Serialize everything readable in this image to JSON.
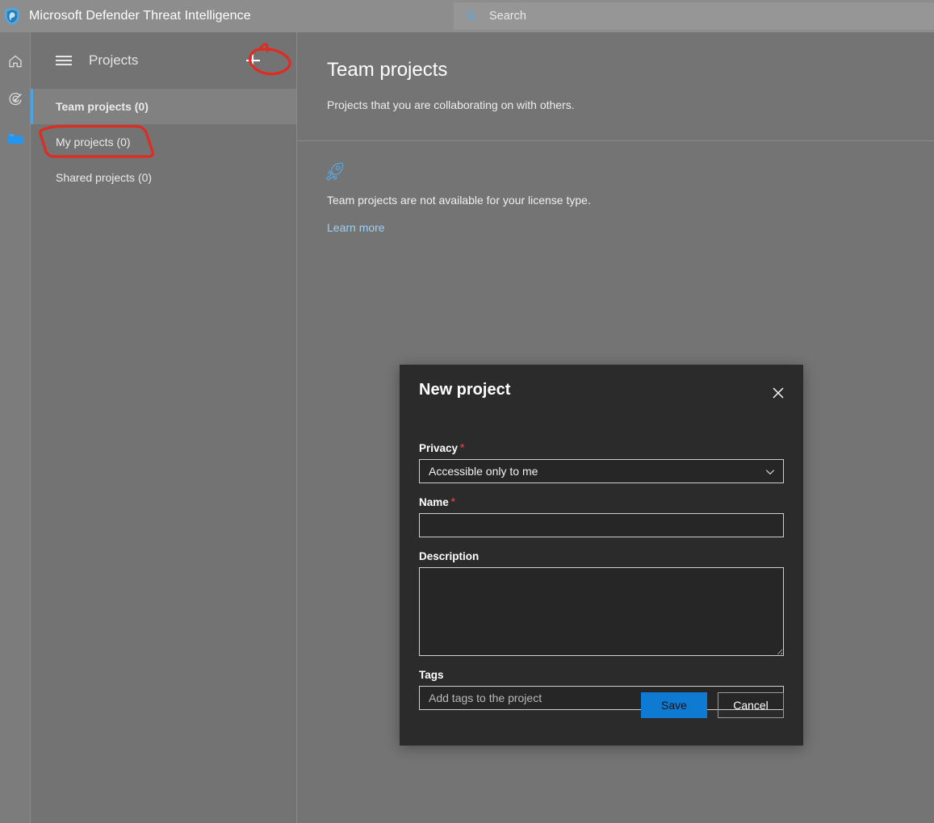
{
  "app": {
    "title": "Microsoft Defender Threat Intelligence",
    "shield_icon": "shield-icon"
  },
  "search": {
    "placeholder": "Search",
    "icon": "search-icon"
  },
  "rail": {
    "items": [
      {
        "name": "home",
        "icon": "home-icon",
        "active": false
      },
      {
        "name": "intel-explorer",
        "icon": "target-icon",
        "active": false
      },
      {
        "name": "projects",
        "icon": "folder-icon",
        "active": true
      }
    ],
    "active_color": "#3ba3ec"
  },
  "panel": {
    "menu_icon": "hamburger-menu-icon",
    "title": "Projects",
    "add_icon": "plus-icon",
    "items": [
      {
        "label": "Team projects (0)",
        "selected": true
      },
      {
        "label": "My projects (0)",
        "selected": false
      },
      {
        "label": "Shared projects (0)",
        "selected": false
      }
    ],
    "selected_accent": "#4da3e0"
  },
  "main": {
    "title": "Team projects",
    "subtitle": "Projects that you are collaborating on with others.",
    "empty_icon": "rocket-icon",
    "empty_message": "Team projects are not available for your license type.",
    "learn_more": "Learn more",
    "link_color": "#9fd0f2"
  },
  "annotations": {
    "color": "#e02b20",
    "marks": [
      {
        "name": "add-button-circle",
        "target": "plus-icon"
      },
      {
        "name": "my-projects-highlight",
        "target": "My projects (0)"
      }
    ]
  },
  "modal": {
    "title": "New project",
    "close_icon": "close-icon",
    "fields": {
      "privacy": {
        "label": "Privacy",
        "required": true,
        "value": "Accessible only to me",
        "chevron_icon": "chevron-down-icon"
      },
      "name": {
        "label": "Name",
        "required": true,
        "value": "",
        "placeholder": ""
      },
      "description": {
        "label": "Description",
        "required": false,
        "value": "",
        "placeholder": ""
      },
      "tags": {
        "label": "Tags",
        "required": false,
        "value": "",
        "placeholder": "Add tags to the project"
      }
    },
    "save_label": "Save",
    "cancel_label": "Cancel",
    "required_marker": "*",
    "primary_color": "#0e7ad1"
  }
}
